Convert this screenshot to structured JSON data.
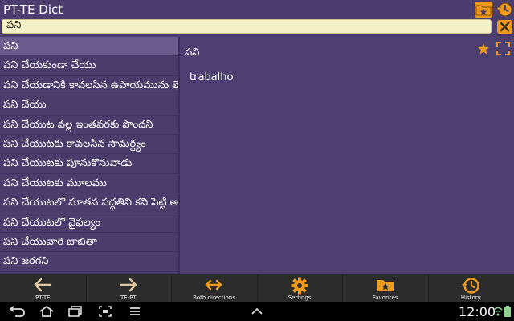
{
  "app": {
    "title": "PT-TE Dict"
  },
  "search": {
    "value": "పని"
  },
  "word_list": [
    {
      "text": "పని",
      "selected": true
    },
    {
      "text": "పని చేయకుండా చేయు"
    },
    {
      "text": "పని చేయడానికి కావలసిన ఉపాయమును తె"
    },
    {
      "text": "పని చేయు"
    },
    {
      "text": "పని చేయుట వల్ల ఇంతవరకు పొందని"
    },
    {
      "text": "పని చేయుటకు కావలసిన సామర్థ్యం"
    },
    {
      "text": "పని చేయుటకు పూనుకొనువాడు"
    },
    {
      "text": "పని చేయుటకు మూలము"
    },
    {
      "text": "పని చేయుటలో నూతన పద్ధతిని కని పెట్టి అ"
    },
    {
      "text": "పని చేయుటలో వైఫల్యం"
    },
    {
      "text": "పని చేయువారి జాబితా"
    },
    {
      "text": "పని జరగని"
    }
  ],
  "detail": {
    "headword": "పని",
    "translation": "trabalho"
  },
  "bottom_nav": [
    {
      "label": "PT-TE",
      "icon": "arrow-left-icon"
    },
    {
      "label": "TE-PT",
      "icon": "arrow-right-icon"
    },
    {
      "label": "Both directions",
      "icon": "arrows-both-icon"
    },
    {
      "label": "Settings",
      "icon": "gear-icon"
    },
    {
      "label": "Favorites",
      "icon": "favorites-folder-icon"
    },
    {
      "label": "History",
      "icon": "history-icon"
    }
  ],
  "status": {
    "time": "12:00"
  },
  "colors": {
    "accent": "#ee9a1c",
    "background": "#4a3d6b",
    "search_bg": "#f5f1c6",
    "selected_row": "#6a5d8e"
  }
}
